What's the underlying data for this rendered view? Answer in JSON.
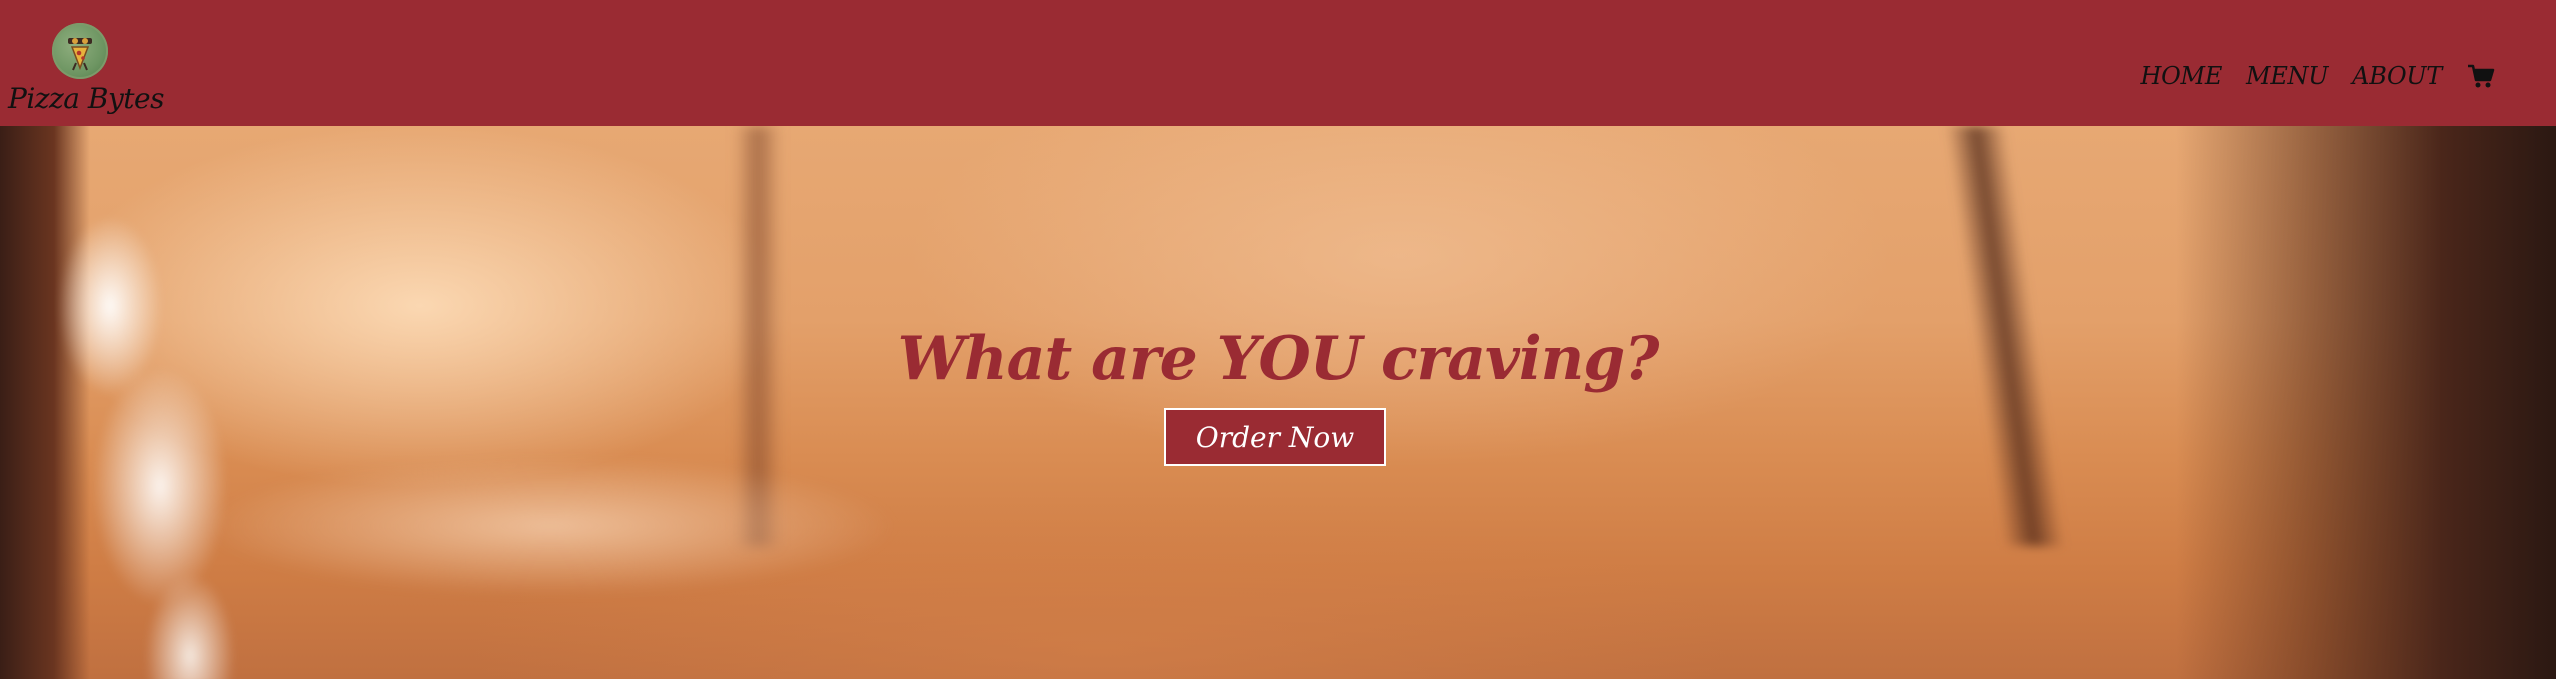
{
  "header": {
    "brand_name": "Pizza Bytes",
    "logo_icon": "pizza-slice-logo-icon",
    "background_color": "#9a2b33",
    "nav": [
      {
        "label": "HOME"
      },
      {
        "label": "MENU"
      },
      {
        "label": "ABOUT"
      }
    ],
    "cart_icon": "shopping-cart-icon"
  },
  "hero": {
    "headline": "What are YOU craving?",
    "cta_label": "Order Now",
    "accent_color": "#9a2b33"
  }
}
